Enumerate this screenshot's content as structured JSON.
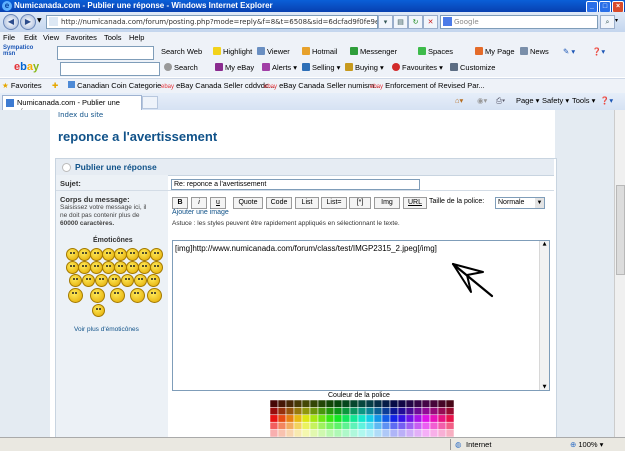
{
  "window": {
    "title": "Numicanada.com - Publier une réponse - Windows Internet Explorer"
  },
  "address": {
    "url": "http://numicanada.com/forum/posting.php?mode=reply&f=8&t=6508&sid=6dcfad9f0fe9e97814b699de11",
    "search_placeholder": "Google"
  },
  "menu": [
    "File",
    "Edit",
    "View",
    "Favorites",
    "Tools",
    "Help"
  ],
  "toolbar1": {
    "search_web": "Search Web",
    "highlight": "Highlight",
    "viewer": "Viewer",
    "hotmail": "Hotmail",
    "messenger": "Messenger",
    "spaces": "Spaces",
    "mypage": "My Page",
    "news": "News"
  },
  "toolbar2": {
    "search": "Search",
    "myebay": "My eBay",
    "alerts": "Alerts",
    "selling": "Selling",
    "buying": "Buying",
    "favourites": "Favourites",
    "customize": "Customize"
  },
  "favorites": {
    "label": "Favorites",
    "links": [
      "Canadian Coin Categorie",
      "eBay Canada Seller cddvdc...",
      "eBay Canada Seller numism...",
      "Enforcement of Revised Par..."
    ]
  },
  "tab": {
    "label": "Numicanada.com - Publier une réponse"
  },
  "cmdbar": {
    "page": "Page",
    "safety": "Safety",
    "tools": "Tools"
  },
  "page": {
    "crumb": "Index du site",
    "title": "reponce a l'avertissement",
    "panel_title": "Publier une réponse",
    "subject_label": "Sujet:",
    "subject_value": "Re: reponce a l'avertissement",
    "body_label": "Corps du message:",
    "body_help_1": "Saisissez votre message ici, il",
    "body_help_2": "ne doit pas contenir plus de",
    "body_help_3": "60000 caractères.",
    "emoticons_title": "Émoticônes",
    "more_emoticons": "Voir plus d'émoticônes",
    "format_buttons": [
      "B",
      "i",
      "u",
      "Quote",
      "Code",
      "List",
      "List=",
      "[*]",
      "Img",
      "URL"
    ],
    "font_size_label": "Taille de la police:",
    "font_size_value": "Normale",
    "add_image": "Ajouter une image",
    "tip": "Astuce : les styles peuvent être rapidement appliqués en sélectionnant le texte.",
    "message": "[img]http://www.numicanada.com/forum/class/test/IMGP2315_2.jpeg[/img]",
    "color_label": "Couleur de la police"
  },
  "status": {
    "zone": "Internet",
    "zoom": "100%"
  },
  "colors": {
    "accent": "#105289",
    "panel_bg": "#ecf1f6"
  }
}
